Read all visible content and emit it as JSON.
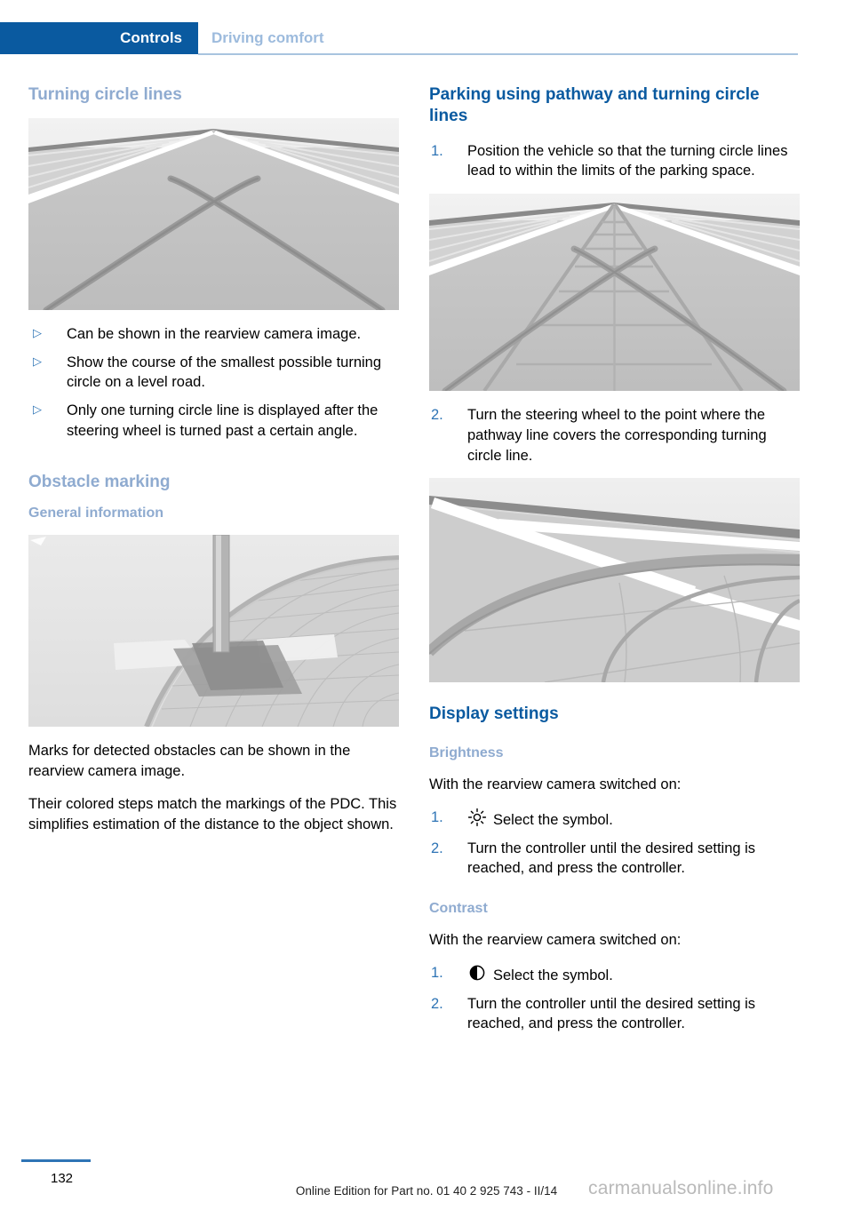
{
  "header": {
    "active_tab": "Controls",
    "secondary_tab": "Driving comfort"
  },
  "left_column": {
    "heading_turning": "Turning circle lines",
    "figure_turning_alt": "rearview-camera-turning-circle-lines",
    "bullets": [
      "Can be shown in the rearview camera image.",
      "Show the course of the smallest possible turning circle on a level road.",
      "Only one turning circle line is displayed after the steering wheel is turned past a certain angle."
    ],
    "bullet_marker": "▷",
    "heading_obstacle": "Obstacle marking",
    "heading_general": "General information",
    "figure_obstacle_alt": "obstacle-marking-pole-on-pavement",
    "paragraphs": [
      "Marks for detected obstacles can be shown in the rearview camera image.",
      "Their colored steps match the markings of the PDC. This simplifies estimation of the distance to the object shown."
    ]
  },
  "right_column": {
    "heading_parking": "Parking using pathway and turning circle lines",
    "parking_steps": [
      {
        "number": "1.",
        "text": "Position the vehicle so that the turning circle lines lead to within the limits of the parking space."
      },
      {
        "number": "2.",
        "text": "Turn the steering wheel to the point where the pathway line covers the corresponding turning circle line."
      }
    ],
    "figure_pathway_alt": "pathway-and-turning-circle-lines-overlay",
    "figure_curve_alt": "pathway-line-covering-turning-circle-line",
    "heading_display": "Display settings",
    "brightness": {
      "heading": "Brightness",
      "intro": "With the rearview camera switched on:",
      "steps": [
        {
          "number": "1.",
          "symbol": "brightness-sun-icon",
          "text": "Select the symbol."
        },
        {
          "number": "2.",
          "symbol": "",
          "text": "Turn the controller until the desired setting is reached, and press the controller."
        }
      ]
    },
    "contrast": {
      "heading": "Contrast",
      "intro": "With the rearview camera switched on:",
      "steps": [
        {
          "number": "1.",
          "symbol": "contrast-half-circle-icon",
          "text": "Select the symbol."
        },
        {
          "number": "2.",
          "symbol": "",
          "text": "Turn the controller until the desired setting is reached, and press the controller."
        }
      ]
    }
  },
  "footer": {
    "page_number": "132",
    "edition_note": "Online Edition for Part no. 01 40 2 925 743 - II/14",
    "watermark": "carmanualsonline.info"
  },
  "colors": {
    "tab_blue": "#0a5aa0",
    "heading_blue": "#0a5aa0",
    "heading_light_blue": "#8fabd0",
    "marker_blue": "#2e74b5",
    "rule_blue": "#a8c4df"
  }
}
